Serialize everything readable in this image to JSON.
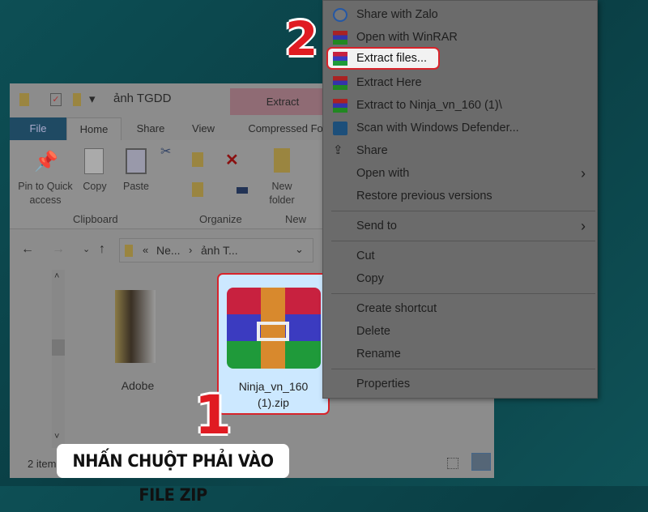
{
  "explorer": {
    "title": "ảnh TGDD",
    "context_tab": "Extract",
    "tabs": [
      "File",
      "Home",
      "Share",
      "View",
      "Compressed Fol"
    ],
    "ribbon": {
      "pin": "Pin to Quick access",
      "copy": "Copy",
      "paste": "Paste",
      "new_folder": "New folder",
      "groups": [
        "Clipboard",
        "Organize",
        "New"
      ]
    },
    "address": {
      "part1": "Ne...",
      "part2": "ảnh T..."
    },
    "files": [
      {
        "name": "Adobe"
      },
      {
        "name": "Ninja_vn_160 (1).zip"
      }
    ],
    "status": "2 item"
  },
  "menu": {
    "items": [
      "Share with Zalo",
      "Open with WinRAR",
      "Extract files...",
      "Extract Here",
      "Extract to Ninja_vn_160 (1)\\",
      "Scan with Windows Defender...",
      "Share",
      "Open with",
      "Restore previous versions",
      "Send to",
      "Cut",
      "Copy",
      "Create shortcut",
      "Delete",
      "Rename",
      "Properties"
    ]
  },
  "annotations": {
    "step1": "1",
    "step2": "2",
    "caption": "NHẤN CHUỘT PHẢI VÀO FILE ZIP"
  },
  "colors": {
    "highlight": "#e01b22",
    "selection": "#cce8ff"
  }
}
